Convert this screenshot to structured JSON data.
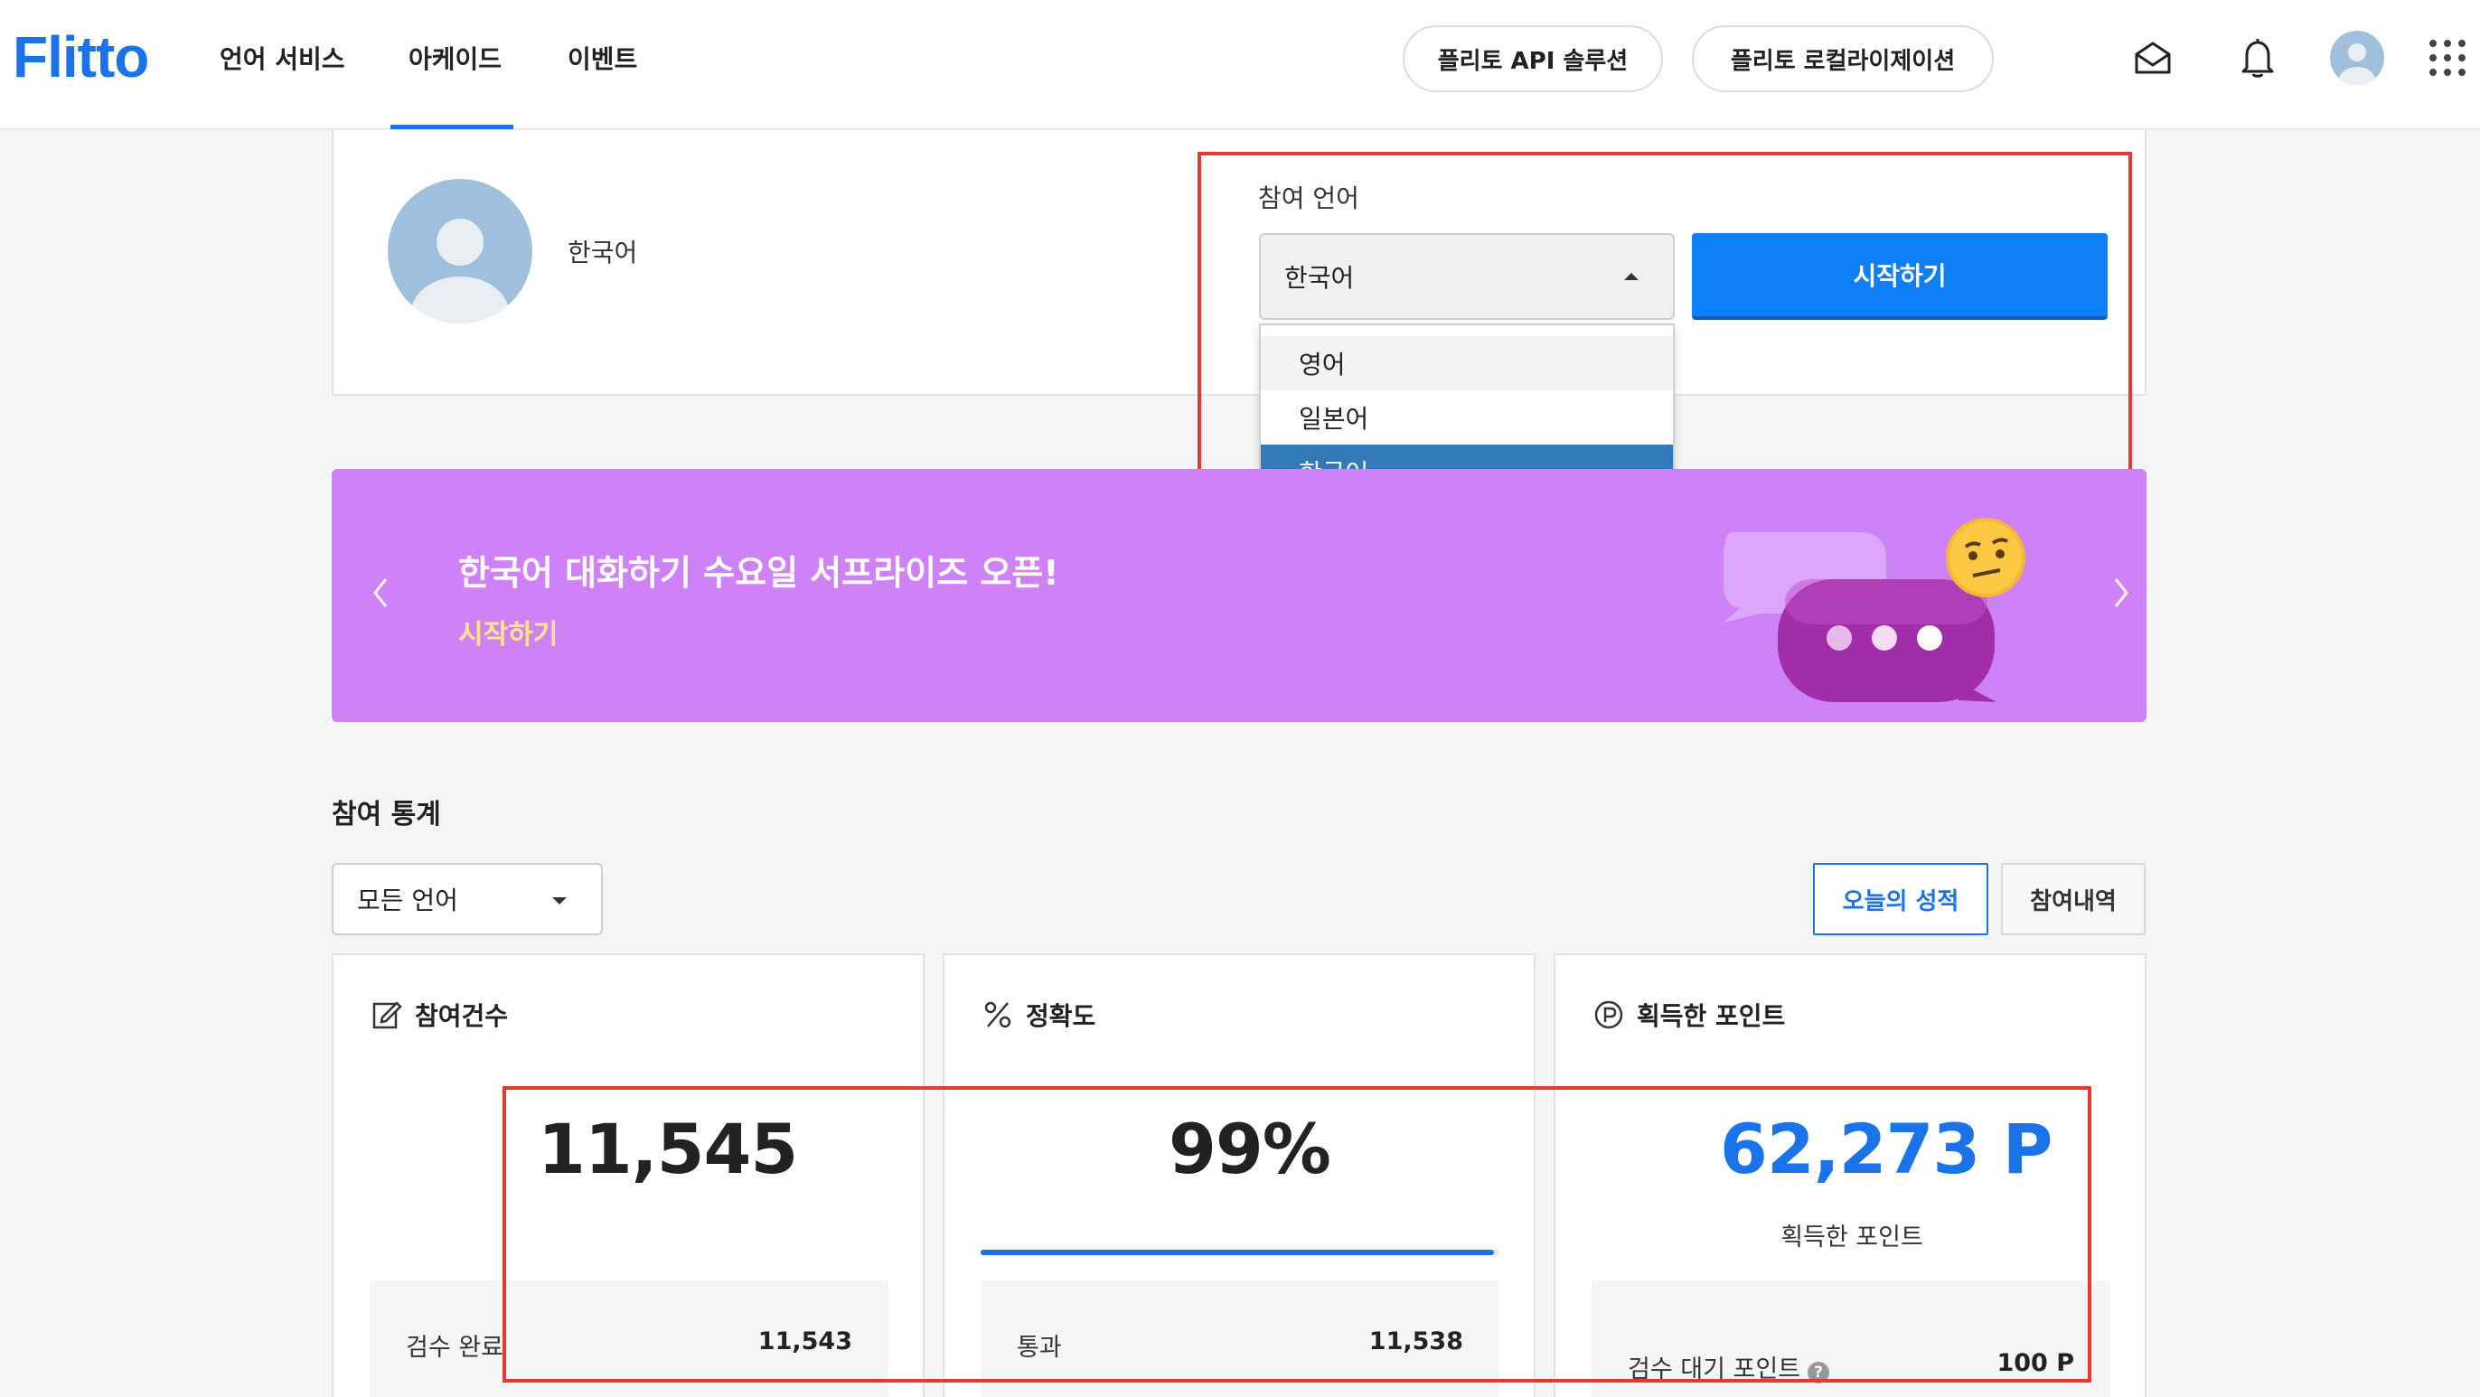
{
  "header": {
    "logo": "Flitto",
    "nav": [
      "언어 서비스",
      "아케이드",
      "이벤트"
    ],
    "active_nav": "아케이드",
    "pills": [
      "플리토 API 솔루션",
      "플리토 로컬라이제이션"
    ],
    "icons": [
      "mail-icon",
      "bell-icon",
      "avatar",
      "apps-grid-icon"
    ]
  },
  "profile": {
    "language": "한국어"
  },
  "participation": {
    "label": "참여 언어",
    "selected": "한국어",
    "options": [
      "영어",
      "일본어",
      "한국어"
    ],
    "start_button": "시작하기"
  },
  "banner": {
    "title": "한국어 대화하기 수요일 서프라이즈 오픈!",
    "link": "시작하기",
    "bg_color": "#cf82f7"
  },
  "stats": {
    "title": "참여 통계",
    "filter": "모든 언어",
    "tabs": [
      "오늘의 성적",
      "참여내역"
    ],
    "cards": [
      {
        "title": "참여건수",
        "value": "11,545",
        "sub_label": "검수 완료",
        "sub_value": "11,543"
      },
      {
        "title": "정확도",
        "value": "99%",
        "progress": 0.99,
        "sub_label": "통과",
        "sub_value": "11,538"
      },
      {
        "title": "획득한 포인트",
        "value": "62,273 P",
        "caption": "획득한 포인트",
        "sub_label": "검수 대기 포인트",
        "sub_value": "100 P"
      }
    ]
  },
  "colors": {
    "accent": "#1a73e8",
    "button": "#0f7ff7",
    "selected_option": "#3279b7",
    "highlight_box": "#e53935"
  }
}
